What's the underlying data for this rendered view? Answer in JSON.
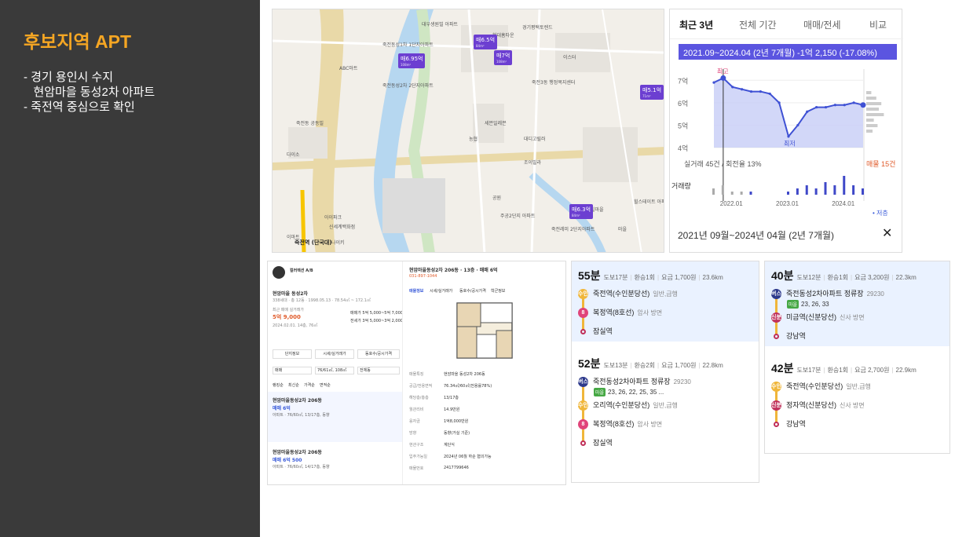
{
  "slide": {
    "title": "후보지역 APT",
    "bullets": [
      "- 경기 용인시 수지",
      "   현암마을 동성2차 아파트",
      "- 죽전역 중심으로 확인"
    ]
  },
  "map": {
    "labels": [
      "대우생원빌 아파트",
      "죽전동성1차 1단지아파트",
      "죽전동성2차 2단지아파트",
      "ABC마트",
      "죽전동 공동빌",
      "아이파크",
      "이마트",
      "신세계백화점",
      "나이키",
      "죽전역 (단국대)",
      "현대홈타운",
      "경기평택토렌드",
      "다이소",
      "죽전3동 행정복지센터",
      "세븐일레븐",
      "농협",
      "대디고릴러",
      "조이빌라",
      "공원",
      "주공2단지 아파트",
      "죽전레미 2단지아파트",
      "빌마을",
      "힐스테이트 아파트",
      "마을",
      "이스터"
    ],
    "pins": [
      {
        "price": "매6.95억",
        "sub": "108m²"
      },
      {
        "price": "매6.5억",
        "sub": "84m²"
      },
      {
        "price": "매7억",
        "sub": "108m²"
      },
      {
        "price": "매5.1억",
        "sub": "71m²"
      },
      {
        "price": "매6.3억",
        "sub": "84m²"
      }
    ],
    "pin_colors": {
      "pin": "#6c3fd1"
    }
  },
  "chart_panel": {
    "tabs": [
      "최근 3년",
      "전체 기간",
      "매매/전세",
      "비교"
    ],
    "active_tab": "최근 3년",
    "banner": "2021.09~2024.04 (2년 7개월)  -1억 2,150 (-17.08%)",
    "high_label": "최고",
    "low_label": "최저",
    "deal_text": "실거래 45건 / 회전율 13%",
    "listing_text": "매물 15건",
    "volume_label": "거래량",
    "legend": "• 저층",
    "footer": "2021년 09월~2024년 04월 (2년 7개월)",
    "close_icon": "✕"
  },
  "chart_data": {
    "type": "area",
    "x": [
      "2021.09",
      "2021.11",
      "2022.01",
      "2022.03",
      "2022.05",
      "2022.07",
      "2022.09",
      "2022.11",
      "2023.01",
      "2023.03",
      "2023.05",
      "2023.07",
      "2023.09",
      "2023.11",
      "2024.01",
      "2024.03",
      "2024.04"
    ],
    "series": [
      {
        "name": "저층",
        "values": [
          6.9,
          7.1,
          6.7,
          6.6,
          6.5,
          6.5,
          6.4,
          6.0,
          4.5,
          5.0,
          5.6,
          5.8,
          5.8,
          5.9,
          5.9,
          6.0,
          5.9
        ]
      }
    ],
    "volume": [
      2,
      3,
      1,
      1,
      1,
      0,
      0,
      0,
      1,
      2,
      3,
      2,
      4,
      3,
      6,
      3,
      2
    ],
    "yticks": [
      "4억",
      "5억",
      "6억",
      "7억"
    ],
    "xticks": [
      "2022.01",
      "2023.01",
      "2024.01"
    ],
    "ylim": [
      4,
      7.5
    ],
    "colors": {
      "line": "#3f51d4",
      "fill": "#c7cdf6",
      "bar": "#3f48c8"
    }
  },
  "listing": {
    "agency": "컬러렉션 A/B",
    "title": "현암마을동성2차 206동 · 13층 · 매매 6억",
    "tel": "031-897-1044",
    "complex": "현암마을 동성2차",
    "complex_info": "338세대 · 총 12동 · 1998.05.13 · 78.54㎡ ~ 172.1㎡",
    "recent_label": "최근 매매 실거래가",
    "recent_price": "5억 9,000",
    "recent_date": "2024.02.01. 14층, 76㎡",
    "sale_range": "매매가 5억 5,000~5억 7,000",
    "rent_range": "전세가 3억 5,000~3억 2,000",
    "buttons": [
      "단지정보",
      "시세/실거래가",
      "동호수/공시가격"
    ],
    "filters": [
      "매매",
      "76/61㎡, 108㎡",
      "전체동"
    ],
    "sort": [
      "랭킹순",
      "최신순",
      "가격순",
      "면적순"
    ],
    "item1_title": "현암마을동성2차 206동",
    "item1_price": "매매 6억",
    "item1_desc": "아파트 · 76/60㎡, 13/17층, 동향",
    "item2_title": "현암마을동성2차 206동",
    "item2_price": "매매 6억 500",
    "item2_desc": "아파트 · 76/60㎡, 14/17층, 동향",
    "detail_tabs": [
      "매물정보",
      "시세/실거래가",
      "동호수/공시가격",
      "학군정보"
    ],
    "table": [
      [
        "매물특징",
        "현암마을 동성2차 206동"
      ],
      [
        "공급/전용면적",
        "76.34㎡/60㎡(전용률78%)"
      ],
      [
        "해당층/총층",
        "13/17층"
      ],
      [
        "월관리비",
        "14.9만원"
      ],
      [
        "융자금",
        "1억8,000만원"
      ],
      [
        "방향",
        "동향(거실 기준)"
      ],
      [
        "현관구조",
        "계단식"
      ],
      [
        "입주가능일",
        "2024년 06월 하순 협의가능"
      ],
      [
        "매물번호",
        "2417799646"
      ]
    ]
  },
  "transit_cards": [
    {
      "routes": [
        {
          "minutes": "55분",
          "details": [
            "도보17분",
            "환승1회",
            "요금 1,700원",
            "23.6km"
          ],
          "highlight": true,
          "stops": [
            {
              "badge": "수인",
              "badge_color": "#f0b63a",
              "name": "죽전역(수인분당선)",
              "sub": "일반,급행"
            },
            {
              "badge": "8",
              "badge_color": "#e0447a",
              "name": "복정역(8호선)",
              "sub": "암사 방면"
            },
            {
              "badge": "",
              "badge_color": "",
              "name": "잠실역",
              "sub": ""
            }
          ]
        },
        {
          "minutes": "52분",
          "details": [
            "도보13분",
            "환승2회",
            "요금 1,700원",
            "22.8km"
          ],
          "highlight": false,
          "stops": [
            {
              "badge": "버스",
              "badge_color": "#2e3a8c",
              "name": "죽전동성2차아파트 정류장",
              "sub": "29230"
            },
            {
              "badge": "수인",
              "badge_color": "#f0b63a",
              "name": "오리역(수인분당선)",
              "sub": "일반,급행"
            },
            {
              "badge": "8",
              "badge_color": "#e0447a",
              "name": "복정역(8호선)",
              "sub": "암사 방면"
            },
            {
              "badge": "",
              "badge_color": "",
              "name": "잠실역",
              "sub": ""
            }
          ],
          "bus_badge": "마을",
          "bus_numbers": "23, 26, 22, 25, 35 ..."
        }
      ]
    },
    {
      "routes": [
        {
          "minutes": "40분",
          "details": [
            "도보12분",
            "환승1회",
            "요금 3,200원",
            "22.3km"
          ],
          "highlight": true,
          "stops": [
            {
              "badge": "버스",
              "badge_color": "#2e3a8c",
              "name": "죽전동성2차아파트 정류장",
              "sub": "29230"
            },
            {
              "badge": "신분",
              "badge_color": "#c0305a",
              "name": "미금역(신분당선)",
              "sub": "신사 방면"
            },
            {
              "badge": "",
              "badge_color": "",
              "name": "강남역",
              "sub": ""
            }
          ],
          "bus_badge": "마을",
          "bus_numbers": "23, 26, 33"
        },
        {
          "minutes": "42분",
          "details": [
            "도보17분",
            "환승1회",
            "요금 2,700원",
            "22.9km"
          ],
          "highlight": false,
          "stops": [
            {
              "badge": "수인",
              "badge_color": "#f0b63a",
              "name": "죽전역(수인분당선)",
              "sub": "일반,급행"
            },
            {
              "badge": "신분",
              "badge_color": "#c0305a",
              "name": "정자역(신분당선)",
              "sub": "신사 방면"
            },
            {
              "badge": "",
              "badge_color": "",
              "name": "강남역",
              "sub": ""
            }
          ]
        }
      ]
    }
  ]
}
